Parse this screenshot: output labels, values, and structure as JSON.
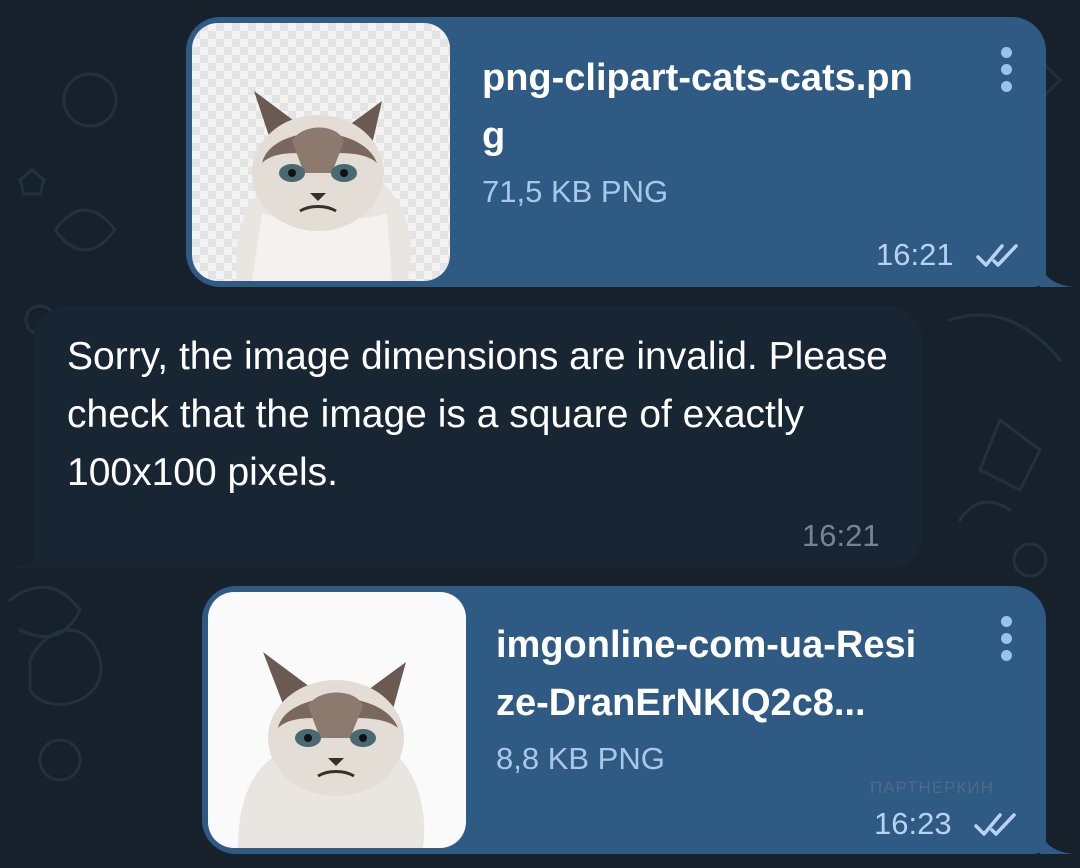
{
  "messages": [
    {
      "type": "file",
      "direction": "outgoing",
      "file_name": "png-clipart-cats-cats.pn\ng",
      "file_meta": "71,5 KB PNG",
      "time": "16:21",
      "status_icon": "double-check-icon"
    },
    {
      "type": "text",
      "direction": "incoming",
      "text": "Sorry, the image dimensions are invalid. Please check that the image is a square of exactly 100x100 pixels.",
      "time": "16:21"
    },
    {
      "type": "file",
      "direction": "outgoing",
      "file_name": "imgonline-com-ua-Resi\nze-DranErNKIQ2c8...",
      "file_meta": "8,8 KB PNG",
      "time": "16:23",
      "status_icon": "double-check-icon"
    }
  ],
  "watermark": "ПАРТНЕРКИН",
  "colors": {
    "background": "#17212b",
    "outgoing_bubble": "#2f5a84",
    "incoming_bubble": "#182533",
    "meta_text": "#a9c8e8"
  }
}
